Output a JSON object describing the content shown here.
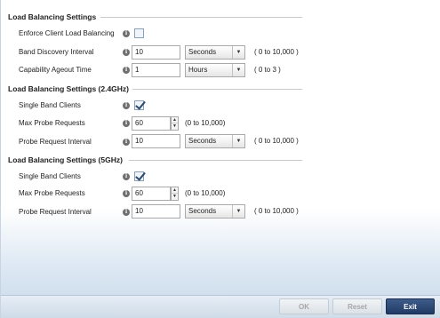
{
  "sections": [
    {
      "title": "Load Balancing Settings",
      "rows": [
        {
          "label": "Enforce Client Load Balancing",
          "checked": false
        },
        {
          "label": "Band Discovery Interval",
          "value": "10",
          "unit": "Seconds",
          "range": "( 0 to 10,000 )"
        },
        {
          "label": "Capability Ageout Time",
          "value": "1",
          "unit": "Hours",
          "range": "( 0 to 3 )"
        }
      ]
    },
    {
      "title": "Load Balancing Settings (2.4GHz)",
      "rows": [
        {
          "label": "Single Band Clients",
          "checked": true
        },
        {
          "label": "Max Probe Requests",
          "value": "60",
          "range": "(0 to 10,000)"
        },
        {
          "label": "Probe Request Interval",
          "value": "10",
          "unit": "Seconds",
          "range": "( 0 to 10,000 )"
        }
      ]
    },
    {
      "title": "Load Balancing Settings (5GHz)",
      "rows": [
        {
          "label": "Single Band Clients",
          "checked": true
        },
        {
          "label": "Max Probe Requests",
          "value": "60",
          "range": "(0 to 10,000)"
        },
        {
          "label": "Probe Request Interval",
          "value": "10",
          "unit": "Seconds",
          "range": "( 0 to 10,000 )"
        }
      ]
    }
  ],
  "icons": {
    "info": "i",
    "dropdown": "▼",
    "spin_up": "▲",
    "spin_down": "▼"
  },
  "footer": {
    "ok_label": "OK",
    "reset_label": "Reset",
    "exit_label": "Exit"
  },
  "colors": {
    "primary_button": "#203a64",
    "checkmark": "#2c4a6e"
  }
}
